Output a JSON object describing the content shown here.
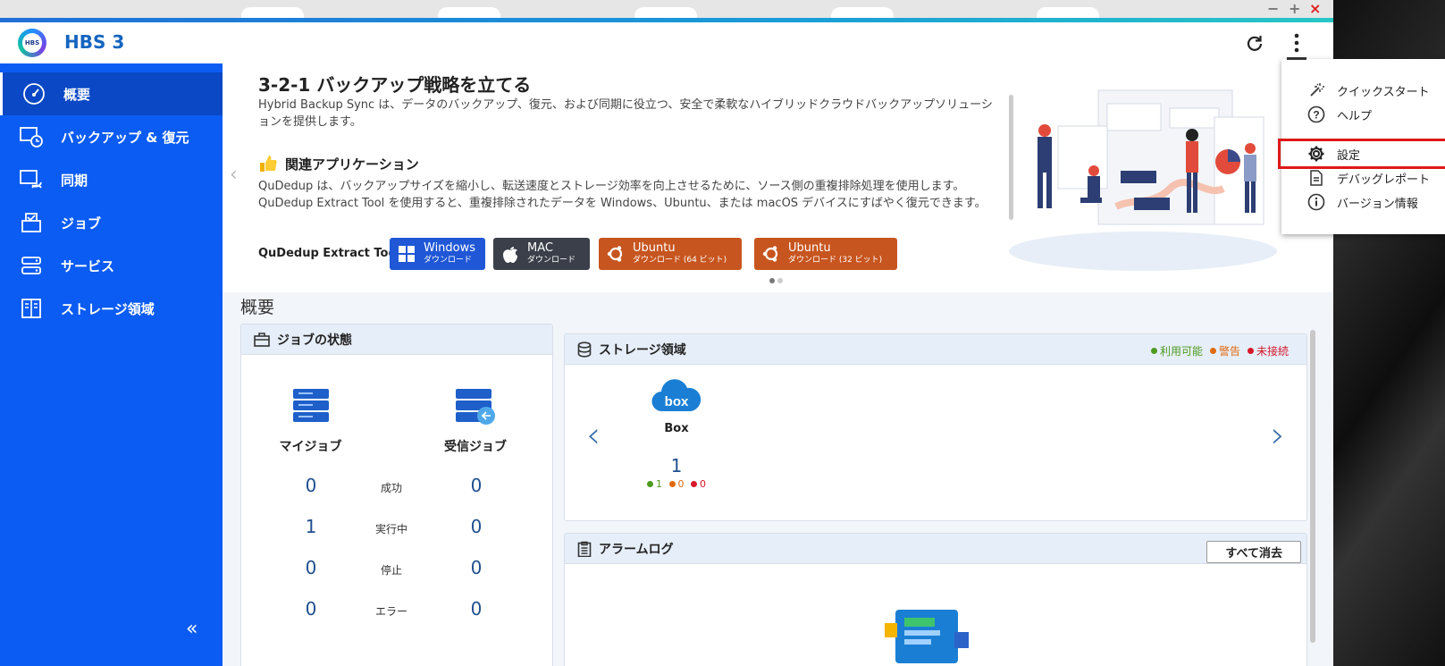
{
  "app": {
    "title": "HBS 3",
    "logo_text": "HBS"
  },
  "window_controls": [
    "−",
    "+",
    "×"
  ],
  "sidebar": {
    "items": [
      {
        "label": "概要",
        "icon": "dashboard-icon",
        "active": true
      },
      {
        "label": "バックアップ & 復元",
        "icon": "backup-restore-icon"
      },
      {
        "label": "同期",
        "icon": "sync-icon"
      },
      {
        "label": "ジョブ",
        "icon": "job-icon"
      },
      {
        "label": "サービス",
        "icon": "service-icon"
      },
      {
        "label": "ストレージ領域",
        "icon": "storage-space-icon"
      }
    ],
    "collapse": "«"
  },
  "banner": {
    "title": "3-2-1 バックアップ戦略を立てる",
    "description": "Hybrid Backup Sync は、データのバックアップ、復元、および同期に役立つ、安全で柔軟なハイブリッドクラウドバックアップソリューションを提供します。",
    "related_title": "関連アプリケーション",
    "related_desc": "QuDedup は、バックアップサイズを縮小し、転送速度とストレージ効率を向上させるために、ソース側の重複排除処理を使用します。 QuDedup Extract Tool を使用すると、重複排除されたデータを Windows、Ubuntu、または macOS デバイスにすばやく復元できます。",
    "tool_label": "QuDedup Extract Tool:",
    "buttons": [
      {
        "title": "Windows",
        "sub": "ダウンロード",
        "color": "#1f57d6"
      },
      {
        "title": "MAC",
        "sub": "ダウンロード",
        "color": "#3b3f49"
      },
      {
        "title": "Ubuntu",
        "sub": "ダウンロード (64 ビット)",
        "color": "#c7551f"
      },
      {
        "title": "Ubuntu",
        "sub": "ダウンロード (32 ビット)",
        "color": "#c7551f"
      }
    ],
    "carousel_page": 1,
    "carousel_total": 2
  },
  "overview": {
    "title": "概要",
    "jobs": {
      "title": "ジョブの状態",
      "col_my": "マイジョブ",
      "col_incoming": "受信ジョブ",
      "rows": [
        {
          "label": "成功",
          "my": "0",
          "incoming": "0"
        },
        {
          "label": "実行中",
          "my": "1",
          "incoming": "0"
        },
        {
          "label": "停止",
          "my": "0",
          "incoming": "0"
        },
        {
          "label": "エラー",
          "my": "0",
          "incoming": "0"
        }
      ]
    },
    "storage": {
      "title": "ストレージ領域",
      "legend": [
        {
          "label": "利用可能",
          "color": "#4d9a1f"
        },
        {
          "label": "警告",
          "color": "#e06a10"
        },
        {
          "label": "未接続",
          "color": "#d6182a"
        }
      ],
      "item": {
        "name": "Box",
        "logo_text": "box",
        "count": "1",
        "available": "1",
        "warning": "0",
        "disconnected": "0"
      }
    },
    "alarm": {
      "title": "アラームログ",
      "clear_label": "すべて消去"
    }
  },
  "menu": {
    "items": [
      {
        "label": "クイックスタート",
        "icon": "magic-wand-icon"
      },
      {
        "label": "ヘルプ",
        "icon": "help-icon"
      },
      {
        "label": "設定",
        "icon": "gear-icon",
        "highlighted": true
      },
      {
        "label": "デバッグレポート",
        "icon": "report-icon"
      },
      {
        "label": "バージョン情報",
        "icon": "info-icon"
      }
    ]
  }
}
